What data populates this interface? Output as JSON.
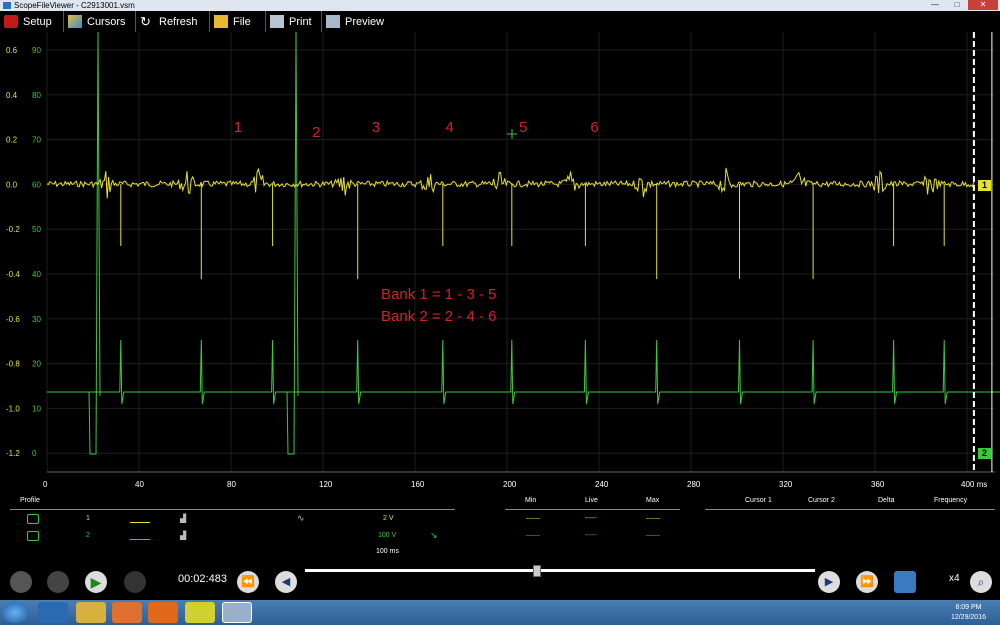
{
  "window": {
    "title": "ScopeFileViewer - C2913001.vsm",
    "minimize": "—",
    "maximize": "□",
    "close": "✕"
  },
  "toolbar": {
    "setup": "Setup",
    "cursors": "Cursors",
    "refresh": "Refresh",
    "file": "File",
    "print": "Print",
    "preview": "Preview"
  },
  "chart_data": {
    "type": "line",
    "x_ticks": [
      "0",
      "40",
      "80",
      "120",
      "160",
      "200",
      "240",
      "280",
      "320",
      "360",
      "400 ms"
    ],
    "y_left_ch1": [
      "0.6",
      "0.4",
      "0.2",
      "0.0",
      "-0.2",
      "-0.4",
      "-0.6",
      "-0.8",
      "-1.0",
      "-1.2"
    ],
    "y_left_ch2": [
      "90",
      "80",
      "70",
      "60",
      "50",
      "40",
      "30",
      "20",
      "10",
      "0"
    ],
    "xlim": [
      0,
      420
    ],
    "series": [
      {
        "name": "1",
        "color": "#e6e22a",
        "baseline": 0.0,
        "spike_times_ms": [
          26,
          61,
          92,
          129,
          166,
          196,
          228,
          259,
          295,
          327,
          362,
          384,
          412
        ]
      },
      {
        "name": "2",
        "color": "#3cc93c",
        "baseline": 10,
        "spike_times_ms": [
          26,
          61,
          92,
          129,
          166,
          196,
          228,
          259,
          295,
          327,
          362,
          384,
          412
        ]
      }
    ],
    "annotations": [
      {
        "text": "1",
        "x_ms": 83
      },
      {
        "text": "2",
        "x_ms": 117
      },
      {
        "text": "3",
        "x_ms": 143
      },
      {
        "text": "4",
        "x_ms": 175
      },
      {
        "text": "5",
        "x_ms": 207
      },
      {
        "text": "6",
        "x_ms": 238
      }
    ],
    "bank_lines": [
      "Bank 1 = 1 - 3 - 5",
      "Bank 2 = 2 - 4 - 6"
    ],
    "channel_markers": [
      "1",
      "2"
    ],
    "cursor_x_ms": 403
  },
  "info": {
    "headers": {
      "profile": "Profile",
      "min": "Min",
      "live": "Live",
      "max": "Max",
      "cursor1": "Cursor 1",
      "cursor2": "Cursor 2",
      "delta": "Delta",
      "frequency": "Frequency"
    },
    "ch1": {
      "num": "1",
      "scale": "2 V",
      "min": "——",
      "live": "-----",
      "max": "——"
    },
    "ch2": {
      "num": "2",
      "scale": "100 V",
      "min": "——",
      "live": "-----",
      "max": "——"
    },
    "timebase": "100 ms"
  },
  "controls": {
    "timer": "00:02:483",
    "zoom": "x4"
  },
  "taskbar": {
    "time": "8:09 PM",
    "date": "12/29/2016"
  }
}
